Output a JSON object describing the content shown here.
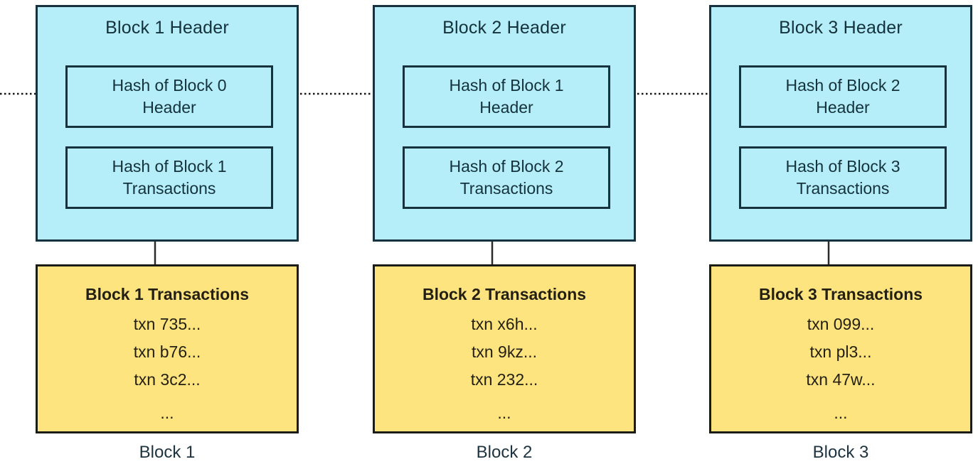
{
  "diagram": {
    "title": "Blockchain block linkage diagram",
    "colors": {
      "header_fill": "#b5eef8",
      "header_stroke": "#16323f",
      "transactions_fill": "#fde47f",
      "transactions_stroke": "#1c1c16",
      "text": "#14323c",
      "connector": "#1b1b1b",
      "background": "#ffffff"
    },
    "ellipsis": "...",
    "blocks": [
      {
        "caption": "Block 1",
        "header_title": "Block 1 Header",
        "hash_prev": {
          "line1": "Hash of Block 0",
          "line2": "Header"
        },
        "hash_txns": {
          "line1": "Hash of Block 1",
          "line2": "Transactions"
        },
        "transactions_title": "Block 1 Transactions",
        "transactions": [
          "txn 735...",
          "txn b76...",
          "txn 3c2..."
        ]
      },
      {
        "caption": "Block 2",
        "header_title": "Block 2 Header",
        "hash_prev": {
          "line1": "Hash of Block 1",
          "line2": "Header"
        },
        "hash_txns": {
          "line1": "Hash of Block 2",
          "line2": "Transactions"
        },
        "transactions_title": "Block 2 Transactions",
        "transactions": [
          "txn x6h...",
          "txn 9kz...",
          "txn 232..."
        ]
      },
      {
        "caption": "Block 3",
        "header_title": "Block 3 Header",
        "hash_prev": {
          "line1": "Hash of Block 2",
          "line2": "Header"
        },
        "hash_txns": {
          "line1": "Hash of Block 3",
          "line2": "Transactions"
        },
        "transactions_title": "Block 3 Transactions",
        "transactions": [
          "txn 099...",
          "txn pl3...",
          "txn 47w..."
        ]
      }
    ],
    "connectors": {
      "chain_arrow_style": "dotted",
      "txn_arrow_style": "solid"
    }
  }
}
